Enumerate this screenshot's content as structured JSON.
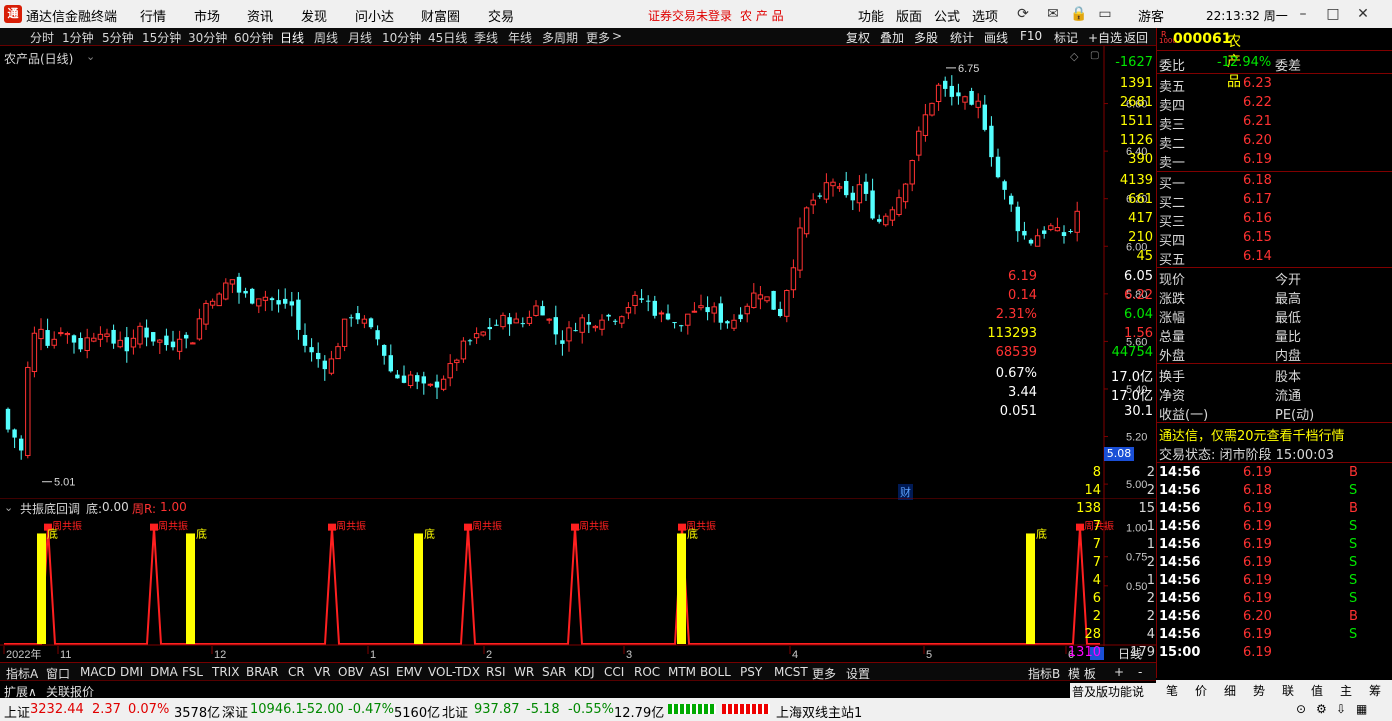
{
  "app": {
    "title": "通达信金融终端",
    "warning": "证券交易未登录",
    "stock_tag": "农 产 品",
    "user": "游客",
    "clock": "22:13:32 周一"
  },
  "menu": [
    "行情",
    "市场",
    "资讯",
    "发现",
    "问小达",
    "财富圈",
    "交易"
  ],
  "menu_right": [
    "功能",
    "版面",
    "公式",
    "选项"
  ],
  "periods": [
    "分时",
    "1分钟",
    "5分钟",
    "15分钟",
    "30分钟",
    "60分钟",
    "日线",
    "周线",
    "月线",
    "10分钟",
    "45日线",
    "季线",
    "年线",
    "多周期",
    "更多"
  ],
  "active_period": "日线",
  "toolbar_right": [
    "复权",
    "叠加",
    "多股",
    "统计",
    "画线",
    "F10",
    "标记",
    "+自选",
    "返回"
  ],
  "chart_title": "农产品(日线)",
  "indicator_title": "共振底回调",
  "indicator_vals": {
    "di_label": "底:",
    "di_val": "0.00",
    "zhou_label": "周R:",
    "zhou_val": "1.00"
  },
  "indicator_mark_di": "底",
  "indicator_mark_zhou": "周共振",
  "cai_label": "财",
  "price_tag": "5.08",
  "bottom_tabs": [
    "指标A",
    "窗口",
    "MACD",
    "DMI",
    "DMA",
    "FSL",
    "TRIX",
    "BRAR",
    "CR",
    "VR",
    "OBV",
    "ASI",
    "EMV",
    "VOL-TDX",
    "RSI",
    "WR",
    "SAR",
    "KDJ",
    "CCI",
    "ROC",
    "MTM",
    "BOLL",
    "PSY",
    "MCST",
    "更多",
    "设置"
  ],
  "bottom_right_tabs": [
    "指标B",
    "模 板",
    "+",
    "-",
    "日线"
  ],
  "ext": [
    "扩展∧",
    "关联报价"
  ],
  "quote": {
    "code": "000061",
    "name": "农 产 品",
    "weibi_label": "委比",
    "weibi": "-12.94%",
    "weicha_label": "委差",
    "weicha": "-1627",
    "sell": [
      {
        "label": "卖五",
        "price": "6.23",
        "vol": "1391"
      },
      {
        "label": "卖四",
        "price": "6.22",
        "vol": "2681"
      },
      {
        "label": "卖三",
        "price": "6.21",
        "vol": "1511"
      },
      {
        "label": "卖二",
        "price": "6.20",
        "vol": "1126"
      },
      {
        "label": "卖一",
        "price": "6.19",
        "vol": "390"
      }
    ],
    "buy": [
      {
        "label": "买一",
        "price": "6.18",
        "vol": "4139"
      },
      {
        "label": "买二",
        "price": "6.17",
        "vol": "661"
      },
      {
        "label": "买三",
        "price": "6.16",
        "vol": "417"
      },
      {
        "label": "买四",
        "price": "6.15",
        "vol": "210"
      },
      {
        "label": "买五",
        "price": "6.14",
        "vol": "45"
      }
    ],
    "stats": [
      {
        "l1": "现价",
        "v1": "6.19",
        "l2": "今开",
        "v2": "6.05"
      },
      {
        "l1": "涨跌",
        "v1": "0.14",
        "l2": "最高",
        "v2": "6.22"
      },
      {
        "l1": "涨幅",
        "v1": "2.31%",
        "l2": "最低",
        "v2": "6.04"
      },
      {
        "l1": "总量",
        "v1": "113293",
        "l2": "量比",
        "v2": "1.56"
      },
      {
        "l1": "外盘",
        "v1": "68539",
        "l2": "内盘",
        "v2": "44754"
      }
    ],
    "stats2": [
      {
        "l1": "换手",
        "v1": "0.67%",
        "l2": "股本",
        "v2": "17.0亿"
      },
      {
        "l1": "净资",
        "v1": "3.44",
        "l2": "流通",
        "v2": "17.0亿"
      },
      {
        "l1": "收益(一)",
        "v1": "0.051",
        "l2": "PE(动)",
        "v2": "30.1"
      }
    ],
    "promo": "通达信，仅需20元查看千档行情",
    "trade_status": "交易状态: 闭市阶段 15:00:03",
    "ticks": [
      {
        "t": "14:56",
        "p": "6.19",
        "v": "8",
        "s": "B",
        "n": "2"
      },
      {
        "t": "14:56",
        "p": "6.18",
        "v": "14",
        "s": "S",
        "n": "2"
      },
      {
        "t": "14:56",
        "p": "6.19",
        "v": "138",
        "s": "B",
        "n": "15"
      },
      {
        "t": "14:56",
        "p": "6.19",
        "v": "7",
        "s": "S",
        "n": "1"
      },
      {
        "t": "14:56",
        "p": "6.19",
        "v": "7",
        "s": "S",
        "n": "1"
      },
      {
        "t": "14:56",
        "p": "6.19",
        "v": "7",
        "s": "S",
        "n": "2"
      },
      {
        "t": "14:56",
        "p": "6.19",
        "v": "4",
        "s": "S",
        "n": "1"
      },
      {
        "t": "14:56",
        "p": "6.19",
        "v": "6",
        "s": "S",
        "n": "2"
      },
      {
        "t": "14:56",
        "p": "6.20",
        "v": "2",
        "s": "B",
        "n": "2"
      },
      {
        "t": "14:56",
        "p": "6.19",
        "v": "28",
        "s": "S",
        "n": "4"
      },
      {
        "t": "15:00",
        "p": "6.19",
        "v": "1310",
        "s": "",
        "n": "179"
      }
    ],
    "bottom_tabs": [
      "笔",
      "价",
      "细",
      "势",
      "联",
      "值",
      "主",
      "筹"
    ]
  },
  "status": {
    "sh_label": "上证",
    "sh": "3232.44",
    "sh_chg": "2.37",
    "sh_pct": "0.07%",
    "sh_amt": "3578亿",
    "sz_label": "深证",
    "sz": "10946.1",
    "sz_chg": "-52.00",
    "sz_pct": "-0.47%",
    "sz_amt": "5160亿",
    "bz_label": "北证",
    "bz": "937.87",
    "bz_chg": "-5.18",
    "bz_pct": "-0.55%",
    "bz_amt": "12.79亿",
    "server": "上海双线主站1"
  },
  "chart_data": {
    "type": "candlestick",
    "y_ticks": [
      "6.60",
      "6.40",
      "6.20",
      "6.00",
      "5.80",
      "5.60",
      "5.40",
      "5.20",
      "5.00"
    ],
    "ylim": [
      4.95,
      6.8
    ],
    "x_labels": [
      "2022年",
      "11",
      "12",
      "1",
      "2",
      "3",
      "4",
      "5",
      "6"
    ],
    "annotations": [
      {
        "text": "6.75"
      },
      {
        "text": "5.01"
      }
    ],
    "indicator": {
      "ylim": [
        0,
        1.1
      ],
      "y_ticks": [
        "1.00",
        "0.75",
        "0.50"
      ]
    }
  }
}
